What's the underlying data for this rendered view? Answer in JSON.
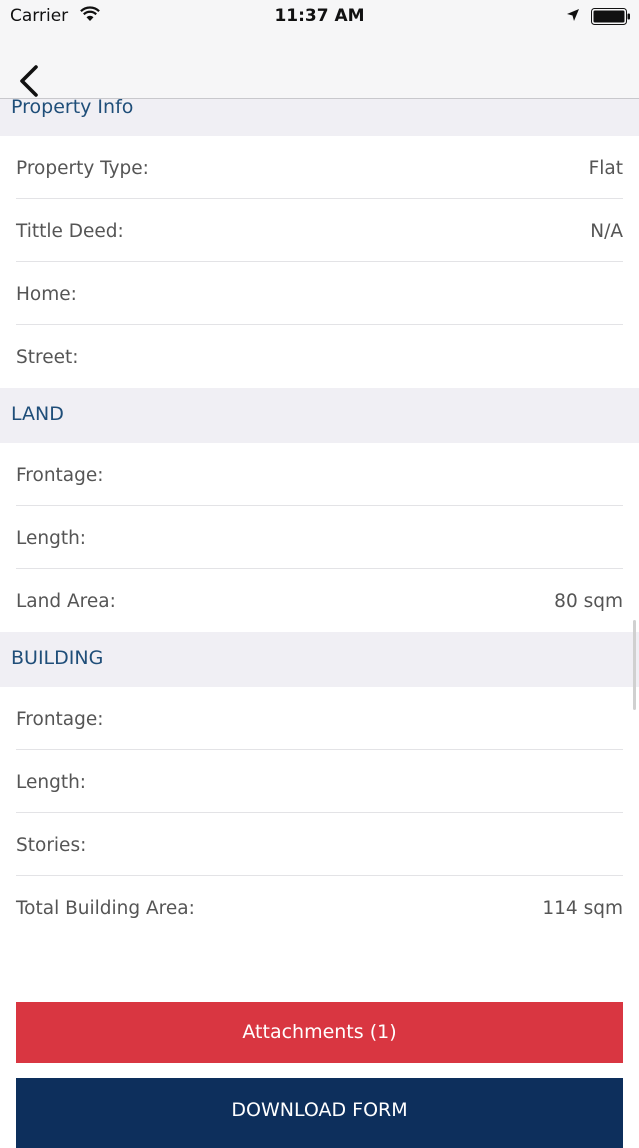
{
  "status_bar": {
    "carrier": "Carrier",
    "time": "11:37 AM"
  },
  "sections": {
    "property_info": {
      "title": "Property Info",
      "rows": [
        {
          "label": "Property Type:",
          "value": "Flat"
        },
        {
          "label": "Tittle Deed:",
          "value": "N/A"
        },
        {
          "label": "Home:",
          "value": ""
        },
        {
          "label": "Street:",
          "value": ""
        }
      ]
    },
    "land": {
      "title": "LAND",
      "rows": [
        {
          "label": "Frontage:",
          "value": ""
        },
        {
          "label": "Length:",
          "value": ""
        },
        {
          "label": "Land Area:",
          "value": "80 sqm"
        }
      ]
    },
    "building": {
      "title": "BUILDING",
      "rows": [
        {
          "label": "Frontage:",
          "value": ""
        },
        {
          "label": "Length:",
          "value": ""
        },
        {
          "label": "Stories:",
          "value": ""
        },
        {
          "label": "Total Building Area:",
          "value": "114 sqm"
        }
      ]
    }
  },
  "buttons": {
    "attachments_label": "Attachments (1)",
    "download_label": "DOWNLOAD FORM"
  },
  "colors": {
    "section_title": "#1f4e79",
    "attachments_button": "#d93641",
    "download_button": "#0d2f5c"
  }
}
